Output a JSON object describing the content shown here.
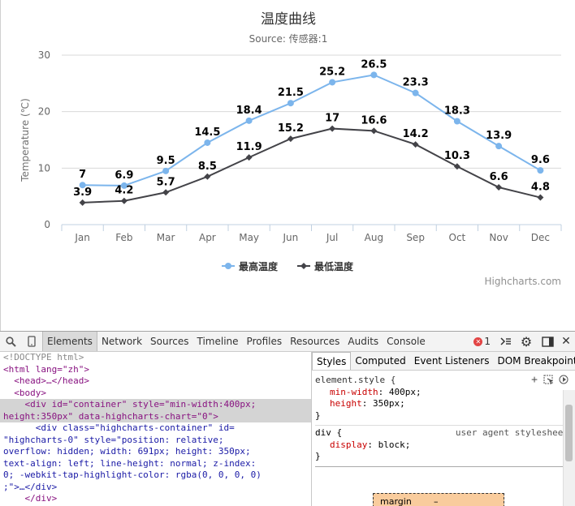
{
  "chart_data": {
    "type": "line",
    "title": "温度曲线",
    "subtitle": "Source: 传感器:1",
    "ylabel": "Temperature (℃)",
    "xlabel": "",
    "categories": [
      "Jan",
      "Feb",
      "Mar",
      "Apr",
      "May",
      "Jun",
      "Jul",
      "Aug",
      "Sep",
      "Oct",
      "Nov",
      "Dec"
    ],
    "ylim": [
      0,
      30
    ],
    "yticks": [
      "0",
      "10",
      "20",
      "30"
    ],
    "grid": true,
    "legend_position": "bottom-center",
    "credits": "Highcharts.com",
    "series": [
      {
        "name": "最高温度",
        "values": [
          7,
          6.9,
          9.5,
          14.5,
          18.4,
          21.5,
          25.2,
          26.5,
          23.3,
          18.3,
          13.9,
          9.6
        ],
        "labels": [
          "7",
          "6.9",
          "9.5",
          "14.5",
          "18.4",
          "21.5",
          "25.2",
          "26.5",
          "23.3",
          "18.3",
          "13.9",
          "9.6"
        ],
        "color": "#7cb5ec",
        "marker": "circle"
      },
      {
        "name": "最低温度",
        "values": [
          3.9,
          4.2,
          5.7,
          8.5,
          11.9,
          15.2,
          17,
          16.6,
          14.2,
          10.3,
          6.6,
          4.8
        ],
        "labels": [
          "3.9",
          "4.2",
          "5.7",
          "8.5",
          "11.9",
          "15.2",
          "17",
          "16.6",
          "14.2",
          "10.3",
          "6.6",
          "4.8"
        ],
        "color": "#434348",
        "marker": "diamond"
      }
    ]
  },
  "devtools": {
    "tabs": [
      "Elements",
      "Network",
      "Sources",
      "Timeline",
      "Profiles",
      "Resources",
      "Audits",
      "Console"
    ],
    "active_tab": "Elements",
    "error_count": "1",
    "dom_lines": [
      {
        "text": "<!DOCTYPE html>",
        "kind": "doctype"
      },
      {
        "text": "<html lang=\"zh\">",
        "kind": "open"
      },
      {
        "text": "  <head>…</head>",
        "kind": "collapsed"
      },
      {
        "text": "  <body>",
        "kind": "open"
      },
      {
        "text": "    <div id=\"container\" style=\"min-width:400px;",
        "kind": "selected"
      },
      {
        "text": "height:350px\" data-highcharts-chart=\"0\">",
        "kind": "selected"
      },
      {
        "text": "      <div class=\"highcharts-container\" id=",
        "kind": "child"
      },
      {
        "text": "\"highcharts-0\" style=\"position: relative;",
        "kind": "child"
      },
      {
        "text": "overflow: hidden; width: 691px; height: 350px;",
        "kind": "child"
      },
      {
        "text": "text-align: left; line-height: normal; z-index:",
        "kind": "child"
      },
      {
        "text": "0; -webkit-tap-highlight-color: rgba(0, 0, 0, 0)",
        "kind": "child"
      },
      {
        "text": ";\">…</div>",
        "kind": "child"
      },
      {
        "text": "    </div>",
        "kind": "close"
      }
    ],
    "style_tabs": [
      "Styles",
      "Computed",
      "Event Listeners",
      "DOM Breakpoints"
    ],
    "active_style_tab": "Styles",
    "element_style_header": "element.style {",
    "element_style_props": [
      {
        "name": "min-width",
        "value": "400px;"
      },
      {
        "name": "height",
        "value": "350px;"
      }
    ],
    "ua_selector": "div {",
    "ua_label": "user agent stylesheet",
    "ua_props": [
      {
        "name": "display",
        "value": "block;"
      }
    ],
    "close_brace": "}",
    "boxmodel_label": "margin",
    "boxmodel_value": "–"
  }
}
